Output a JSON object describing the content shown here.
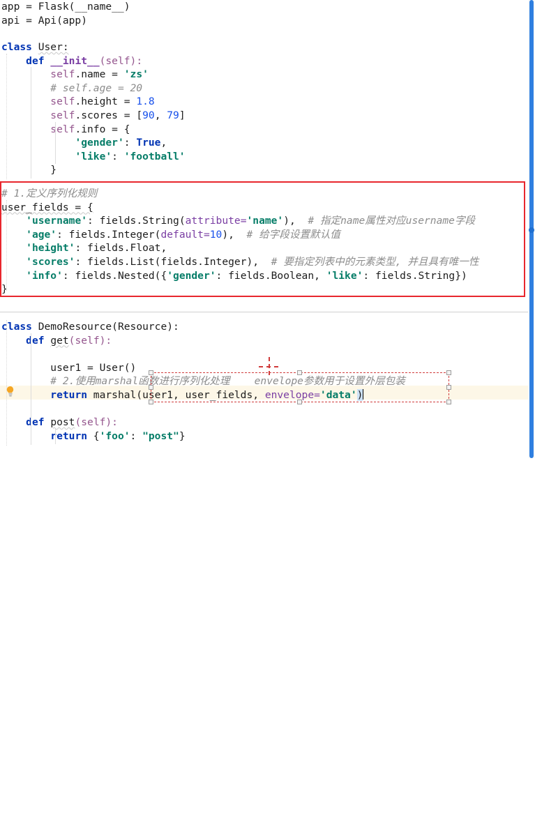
{
  "editor": {
    "language": "python",
    "theme_background": "#ffffff",
    "highlight_line_color": "#fdf6e3",
    "annotation_color": "#e8262d",
    "string_color": "#067d68",
    "keyword_color": "#0033b3",
    "comment_color": "#8c8c8c",
    "number_color": "#1750eb"
  },
  "gutter": {
    "bulb_icon": "lightbulb-icon",
    "bulb_line": 27
  },
  "scrollbar": {
    "marker_icon": "scroll-marker-dot",
    "thumb_color": "#2f7fe0"
  },
  "annotations": [
    {
      "name": "serialization-rules-box",
      "label": ""
    },
    {
      "name": "marshal-usage-box",
      "label": ""
    },
    {
      "name": "crosshair-marker",
      "label": ""
    }
  ],
  "code": {
    "block_app": {
      "l1": "app = Flask(__name__)",
      "l2": "api = Api(app)"
    },
    "block_user": {
      "class_kw": "class",
      "class_name": "User:",
      "def_kw": "def",
      "init_name": "__init__",
      "init_args": "(self):",
      "name_line": "self.name = ",
      "name_val": "'zs'",
      "age_comment": "# self.age = 20",
      "height_line": "self.height = ",
      "height_val": "1.8",
      "scores_line": "self.scores = [",
      "scores_v1": "90",
      "scores_v2": "79",
      "scores_close": "]",
      "info_line": "self.info = {",
      "gender_key": "'gender'",
      "gender_val": "True",
      "like_key": "'like'",
      "like_val": "'football'",
      "close_brace": "}"
    },
    "block_fields": {
      "comment1": "# 1.定义序列化规则",
      "decl": "user_fields = {",
      "username_key": "'username'",
      "username_val": "fields.String(",
      "username_kwarg": "attribute=",
      "username_kwval": "'name'",
      "username_tail": "),",
      "username_comment": "# 指定name属性对应username字段",
      "age_key": "'age'",
      "age_val": "fields.Integer(",
      "age_kwarg": "default=",
      "age_kwval": "10",
      "age_tail": "),",
      "age_comment": "# 给字段设置默认值",
      "height_key": "'height'",
      "height_val": "fields.Float,",
      "scores_key": "'scores'",
      "scores_val": "fields.List(fields.Integer),",
      "scores_comment": "# 要指定列表中的元素类型, 并且具有唯一性",
      "info_key": "'info'",
      "info_val_a": "fields.Nested({",
      "info_gender_key": "'gender'",
      "info_gender_val": ": fields.Boolean, ",
      "info_like_key": "'like'",
      "info_like_val": ": fields.String})",
      "close_brace": "}"
    },
    "block_resource": {
      "class_kw": "class",
      "class_name": "DemoResource(",
      "class_base": "Resource",
      "class_tail": "):",
      "def_kw": "def",
      "get_name": "get",
      "get_args": "(self):",
      "user1_line": "user1 = User()",
      "comment2": "# 2.使用marshal函数进行序列化处理",
      "comment2_tail": "envelope参数用于设置外层包装",
      "return_kw": "return",
      "marshal_call": " marshal(",
      "marshal_args": "user1, user_fields, ",
      "envelope_kwarg": "envelope=",
      "envelope_val": "'data'",
      "marshal_close": ")",
      "post_def_kw": "def",
      "post_name": "post",
      "post_args": "(self):",
      "post_return_kw": "return",
      "post_dict_open": " {",
      "post_key": "'foo'",
      "post_sep": ": ",
      "post_val": "\"post\"",
      "post_dict_close": "}"
    }
  }
}
